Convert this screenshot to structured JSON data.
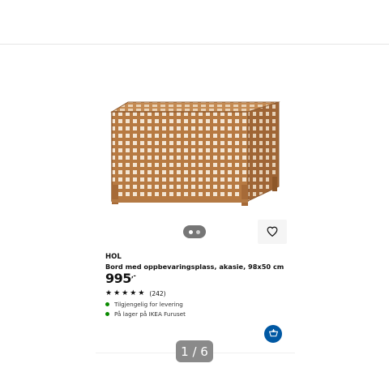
{
  "product": {
    "brand": "HOL",
    "description": "Bord med oppbevaringsplass, akasie, 98x50 cm",
    "price": "995",
    "price_suffix": ",-",
    "rating_value": 5,
    "rating_count": "(242)",
    "availability": [
      {
        "text": "Tilgjengelig for levering",
        "status_color": "#0a8a00"
      },
      {
        "text": "På lager på IKEA Furuset",
        "status_color": "#0a8a00"
      }
    ]
  },
  "gallery": {
    "image_icon": "acacia-storage-table-image",
    "dot_count": 2,
    "active_dot": 1
  },
  "pager": {
    "text": "1 / 6"
  },
  "icons": {
    "favorite": "heart-icon",
    "add_to_cart": "cart-add-icon"
  },
  "colors": {
    "accent": "#0058a3",
    "stock": "#0a8a00"
  }
}
